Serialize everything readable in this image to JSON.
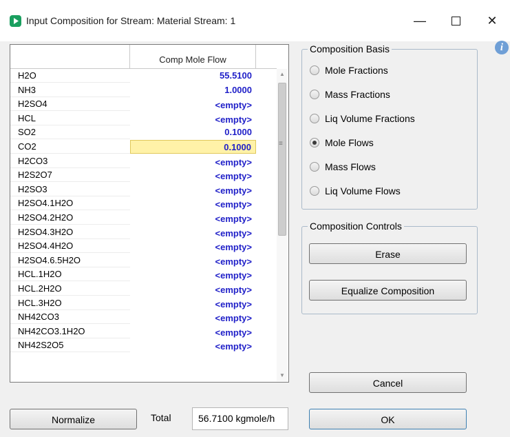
{
  "window": {
    "title": "Input Composition for Stream: Material Stream: 1",
    "minimize_glyph": "—",
    "close_glyph": "✕",
    "info_glyph": "i"
  },
  "grid": {
    "column_header": "Comp Mole Flow",
    "rows": [
      {
        "name": "H2O",
        "value": "55.5100"
      },
      {
        "name": "NH3",
        "value": "1.0000"
      },
      {
        "name": "H2SO4",
        "value": "<empty>"
      },
      {
        "name": "HCL",
        "value": "<empty>"
      },
      {
        "name": "SO2",
        "value": "0.1000"
      },
      {
        "name": "CO2",
        "value": "0.1000"
      },
      {
        "name": "H2CO3",
        "value": "<empty>"
      },
      {
        "name": "H2S2O7",
        "value": "<empty>"
      },
      {
        "name": "H2SO3",
        "value": "<empty>"
      },
      {
        "name": "H2SO4.1H2O",
        "value": "<empty>"
      },
      {
        "name": "H2SO4.2H2O",
        "value": "<empty>"
      },
      {
        "name": "H2SO4.3H2O",
        "value": "<empty>"
      },
      {
        "name": "H2SO4.4H2O",
        "value": "<empty>"
      },
      {
        "name": "H2SO4.6.5H2O",
        "value": "<empty>"
      },
      {
        "name": "HCL.1H2O",
        "value": "<empty>"
      },
      {
        "name": "HCL.2H2O",
        "value": "<empty>"
      },
      {
        "name": "HCL.3H2O",
        "value": "<empty>"
      },
      {
        "name": "NH42CO3",
        "value": "<empty>"
      },
      {
        "name": "NH42CO3.1H2O",
        "value": "<empty>"
      },
      {
        "name": "NH42S2O5",
        "value": "<empty>"
      }
    ],
    "selected_row": "CO2"
  },
  "composition_basis": {
    "title": "Composition Basis",
    "options": [
      "Mole Fractions",
      "Mass Fractions",
      "Liq Volume Fractions",
      "Mole Flows",
      "Mass Flows",
      "Liq Volume Flows"
    ],
    "selected": "Mole Flows"
  },
  "composition_controls": {
    "title": "Composition Controls",
    "erase_label": "Erase",
    "equalize_label": "Equalize Composition"
  },
  "footer": {
    "normalize_label": "Normalize",
    "total_label": "Total",
    "total_value": "56.7100 kgmole/h",
    "cancel_label": "Cancel",
    "ok_label": "OK"
  }
}
